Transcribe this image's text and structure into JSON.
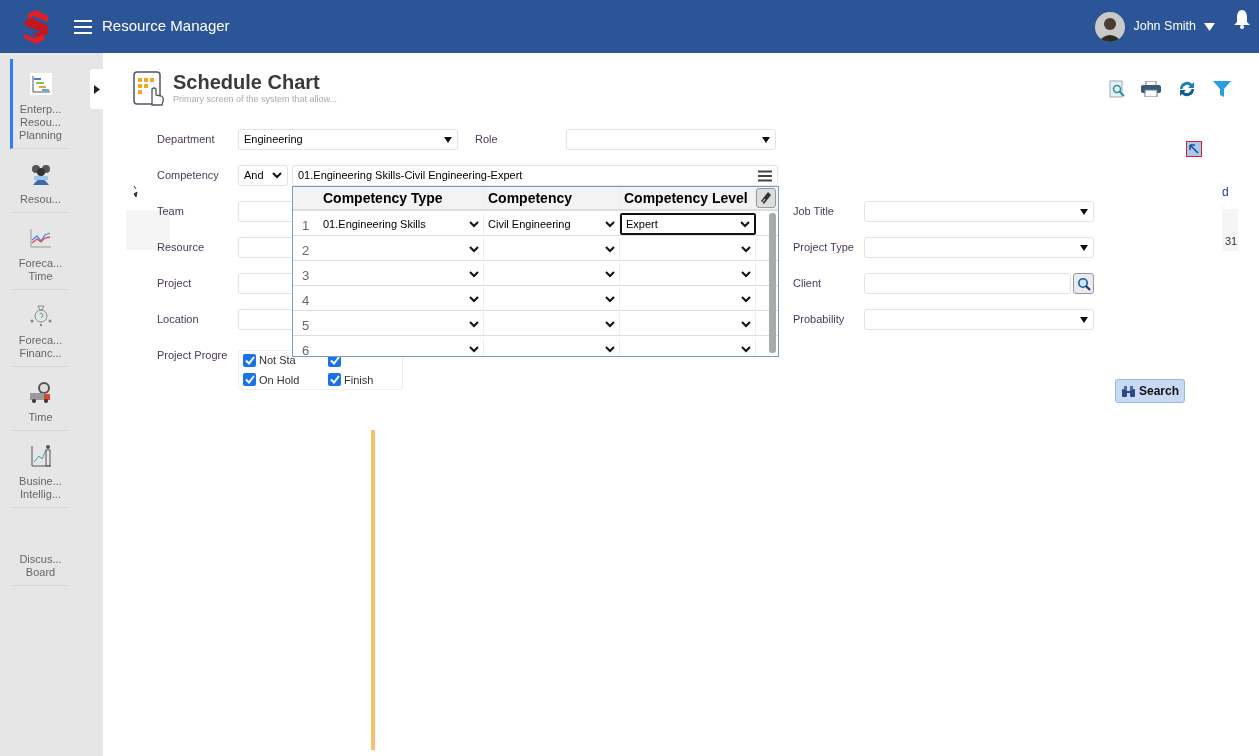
{
  "header": {
    "app_title": "Resource Manager",
    "user": {
      "name": "John Smith"
    }
  },
  "sidebar": {
    "items": [
      {
        "kind": "gantt",
        "lines": [
          "Enterp...",
          "Resou...",
          "Planning"
        ],
        "selected": true
      },
      {
        "kind": "people",
        "lines": [
          "Resou..."
        ],
        "selected": false
      },
      {
        "kind": "chart",
        "lines": [
          "Foreca...",
          "Time"
        ],
        "selected": false
      },
      {
        "kind": "money",
        "lines": [
          "Foreca...",
          "Financ..."
        ],
        "selected": false
      },
      {
        "kind": "time",
        "lines": [
          "Time"
        ],
        "selected": false
      },
      {
        "kind": "bi",
        "lines": [
          "Busine...",
          "Intellig..."
        ],
        "selected": false
      },
      {
        "kind": "none",
        "lines": [
          "Discus...",
          "Board"
        ],
        "selected": false
      }
    ]
  },
  "page": {
    "title": "Schedule Chart",
    "subtitle": "Primary screen of the system that allow..."
  },
  "form": {
    "department": {
      "label": "Department",
      "value": "Engineering"
    },
    "role": {
      "label": "Role"
    },
    "competency": {
      "label": "Competency",
      "operator": "And",
      "value": "01.Engineering Skills-Civil Engineering-Expert"
    },
    "left_fields": [
      {
        "label": "Team"
      },
      {
        "label": "Resource"
      },
      {
        "label": "Project"
      },
      {
        "label": "Location"
      }
    ],
    "right_fields": [
      {
        "label": "Job Title",
        "kind": "select"
      },
      {
        "label": "Project Type",
        "kind": "select"
      },
      {
        "label": "Client",
        "kind": "lookup"
      },
      {
        "label": "Probability",
        "kind": "select"
      }
    ],
    "progress": {
      "label": "Project Progre",
      "options": [
        {
          "label": "Not Sta",
          "checked": true
        },
        {
          "checked": true
        },
        {
          "label": "On Hold",
          "checked": true
        },
        {
          "label": "Finish",
          "checked": true
        }
      ]
    },
    "search_button": "Search"
  },
  "competency_grid": {
    "columns": [
      "Competency Type",
      "Competency",
      "Competency Level"
    ],
    "rows": [
      {
        "number": "1",
        "type": "01.Engineering Skills",
        "competency": "Civil Engineering",
        "level": "Expert",
        "selected": true
      },
      {
        "number": "2",
        "selected": false
      },
      {
        "number": "3",
        "selected": false
      },
      {
        "number": "4",
        "selected": false
      },
      {
        "number": "5",
        "selected": false
      },
      {
        "number": "6",
        "selected": false
      }
    ]
  },
  "background": {
    "right_text": "d",
    "right_cell": "31"
  }
}
